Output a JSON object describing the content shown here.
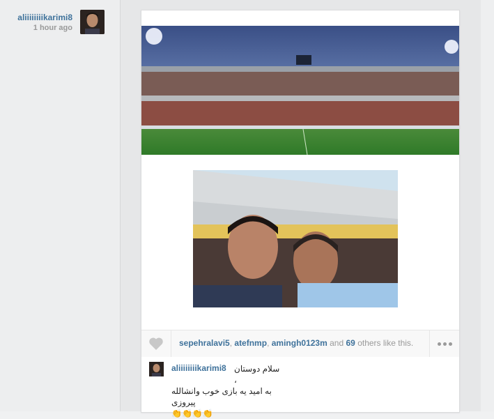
{
  "post": {
    "author_username": "aliiiiiiiikarimi8",
    "time_ago": "1 hour ago"
  },
  "likes": {
    "likers": [
      "sepehralavi5",
      "atefnmp",
      "amingh0123m"
    ],
    "and_text": "and",
    "others_count": "69",
    "suffix_text": "others like this."
  },
  "comment": {
    "username": "aliiiiiiiikarimi8",
    "line1": "سلام دوستان ،",
    "line2": "به امید یه بازی خوب وانشالله پیروزی",
    "line3": "👏👏👏👏"
  },
  "icons": {
    "like": "heart-icon",
    "more": "more-dots-icon"
  },
  "colors": {
    "link": "#3f729b",
    "muted": "#999999"
  }
}
